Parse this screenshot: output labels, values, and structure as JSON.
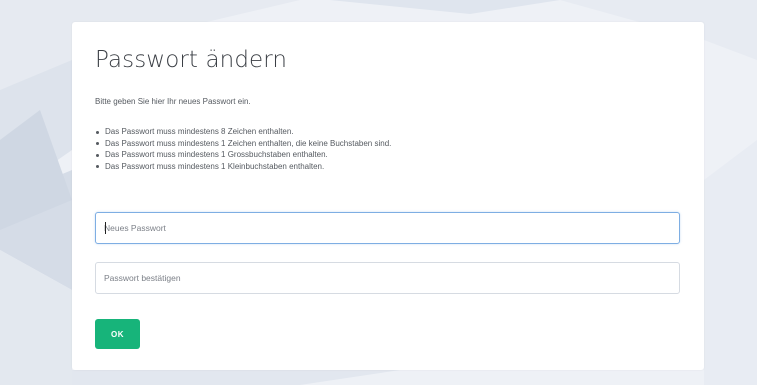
{
  "page": {
    "title": "Passwort ändern",
    "intro": "Bitte geben Sie hier Ihr neues Passwort ein.",
    "requirements": [
      "Das Passwort muss mindestens 8 Zeichen enthalten.",
      "Das Passwort muss mindestens 1 Zeichen enthalten, die keine Buchstaben sind.",
      "Das Passwort muss mindestens 1 Grossbuchstaben enthalten.",
      "Das Passwort muss mindestens 1 Kleinbuchstaben enthalten."
    ]
  },
  "form": {
    "new_password": {
      "placeholder": "Neues Passwort",
      "value": ""
    },
    "confirm_password": {
      "placeholder": "Passwort bestätigen",
      "value": ""
    },
    "submit_label": "OK"
  },
  "colors": {
    "accent": "#17b47a",
    "focus_border": "#7eaee3",
    "background": "#eef1f6"
  }
}
